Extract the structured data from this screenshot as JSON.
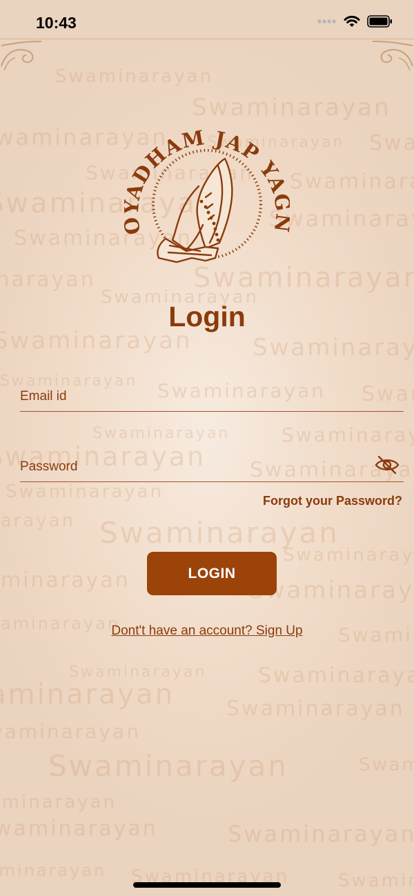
{
  "status_bar": {
    "time": "10:43"
  },
  "watermark": {
    "text": "Swaminarayan"
  },
  "logo": {
    "text": "LOYADHAM JAP YAGNA"
  },
  "login": {
    "title": "Login",
    "email_label": "Email id",
    "password_label": "Password",
    "forgot_label": "Forgot your Password?",
    "button_label": "LOGIN",
    "signup_label": "Dont't have an account? Sign Up"
  },
  "colors": {
    "brand": "#8a3b0c",
    "button": "#9c4309",
    "background": "#f1dcc9"
  }
}
